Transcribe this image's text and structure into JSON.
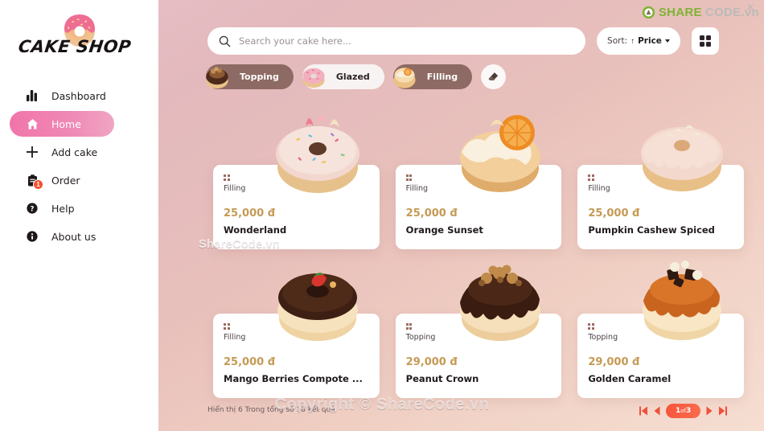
{
  "brand": {
    "name": "CAKE SHOP",
    "logo_icon": "donut-icon"
  },
  "sidebar": {
    "items": [
      {
        "label": "Dashboard",
        "icon": "bar-chart-icon",
        "active": false,
        "badge": ""
      },
      {
        "label": "Home",
        "icon": "home-icon",
        "active": true,
        "badge": ""
      },
      {
        "label": "Add cake",
        "icon": "plus-icon",
        "active": false,
        "badge": ""
      },
      {
        "label": "Order",
        "icon": "clipboard-icon",
        "active": false,
        "badge": "1"
      },
      {
        "label": "Help",
        "icon": "question-circle-icon",
        "active": false,
        "badge": ""
      },
      {
        "label": "About us",
        "icon": "info-circle-icon",
        "active": false,
        "badge": ""
      }
    ]
  },
  "search": {
    "placeholder": "Search your cake here...",
    "value": "",
    "icon": "search-icon"
  },
  "sort": {
    "label": "Sort:",
    "direction_arrow": "↑",
    "value": "Price",
    "caret_icon": "chevron-down-icon"
  },
  "view_toggle": {
    "icon": "grid-view-icon"
  },
  "filters": {
    "chips": [
      {
        "label": "Topping",
        "style": "dark",
        "thumb": "donut-chocolate-nut-thumb"
      },
      {
        "label": "Glazed",
        "style": "light",
        "thumb": "donut-pink-sprinkle-thumb"
      },
      {
        "label": "Filling",
        "style": "dark",
        "thumb": "donut-orange-cream-thumb"
      }
    ],
    "clear_icon": "eraser-icon"
  },
  "products": [
    {
      "category": "Filling",
      "price": "25,000 đ",
      "name": "Wonderland",
      "image": "donut-white-glaze-sprinkles"
    },
    {
      "category": "Filling",
      "price": "25,000 đ",
      "name": "Orange Sunset",
      "image": "donut-orange-cream-slice"
    },
    {
      "category": "Filling",
      "price": "25,000 đ",
      "name": "Pumpkin Cashew Spiced",
      "image": "donut-pink-glaze-cashew"
    },
    {
      "category": "Filling",
      "price": "25,000 đ",
      "name": " Mango Berries Compote ...",
      "image": "donut-chocolate-strawberry"
    },
    {
      "category": "Topping",
      "price": "29,000 đ",
      "name": "Peanut Crown",
      "image": "donut-chocolate-peanut"
    },
    {
      "category": "Topping",
      "price": "29,000 đ",
      "name": "Golden Caramel",
      "image": "donut-caramel-popcorn"
    }
  ],
  "footer": {
    "results_text": "Hiển thị 6 Trong tổng số 18 kết quả",
    "pagination": {
      "current_page": "1",
      "of_label": "of",
      "total_pages": "3",
      "first_icon": "skip-first-icon",
      "prev_icon": "chevron-left-icon",
      "next_icon": "chevron-right-icon",
      "last_icon": "skip-last-icon"
    }
  },
  "watermark": {
    "top_green": "SHARE",
    "top_grey": "CODE.vn",
    "center": "Copyright © ShareCode.vn",
    "card": "ShareCode.vn"
  },
  "colors": {
    "accent_pink": "#f075a9",
    "price_gold": "#c59a55",
    "chip_dark": "#8d6a63",
    "pager_red": "#f7553b",
    "badge_red": "#f4502e"
  }
}
